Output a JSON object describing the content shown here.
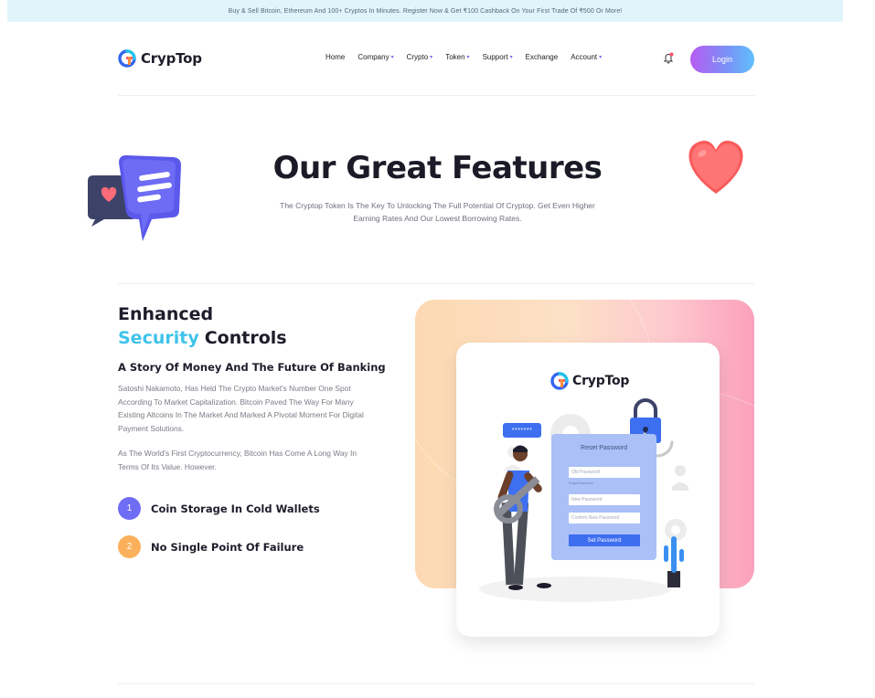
{
  "announcement": "Buy & Sell Bitcoin, Ethereum And 100+ Cryptos In Minutes. Register Now & Get ₹100 Cashback On Your First Trade Of ₹500 Or More!",
  "brand": {
    "name": "CrypTop"
  },
  "nav": {
    "items": [
      {
        "label": "Home",
        "dropdown": false
      },
      {
        "label": "Company",
        "dropdown": true
      },
      {
        "label": "Crypto",
        "dropdown": true
      },
      {
        "label": "Token",
        "dropdown": true
      },
      {
        "label": "Support",
        "dropdown": true
      },
      {
        "label": "Exchange",
        "dropdown": false
      },
      {
        "label": "Account",
        "dropdown": true
      }
    ],
    "login_label": "Login"
  },
  "hero": {
    "title": "Our Great Features",
    "subtitle": "The Cryptop Token Is The Key To Unlocking The Full Potential Of Cryptop. Get Even Higher Earning Rates And Our Lowest Borrowing Rates."
  },
  "feature": {
    "title_line1": "Enhanced",
    "title_accent": "Security",
    "title_rest": "Controls",
    "heading": "A Story Of Money And The Future Of Banking",
    "para1": "Satoshi Nakamoto,  Has Held The Crypto Market's Number One Spot According To Market Capitalization. Bitcoin Paved The Way For Many Existing Altcoins In The Market And Marked A Pivotal Moment For Digital Payment Solutions.",
    "para2": "As The World's First Cryptocurrency, Bitcoin Has Come A Long Way In Terms Of Its Value. However.",
    "bullets": [
      {
        "num": "1",
        "label": "Coin Storage In Cold Wallets",
        "color": "#6f6cf6"
      },
      {
        "num": "2",
        "label": "No Single Point Of Failure",
        "color": "#fbb05b"
      }
    ]
  },
  "illustration": {
    "brand": "CrypTop",
    "bubble": "*******",
    "form_title": "Reset Password",
    "fields": [
      "Old Password",
      "New Password",
      "Confirm New Password"
    ],
    "hint": "Forgot Password",
    "button": "Set Password"
  },
  "colors": {
    "accent": "#3fc3ea",
    "brand_gradient_start": "#b65cf0",
    "brand_gradient_end": "#5fc0fb"
  }
}
